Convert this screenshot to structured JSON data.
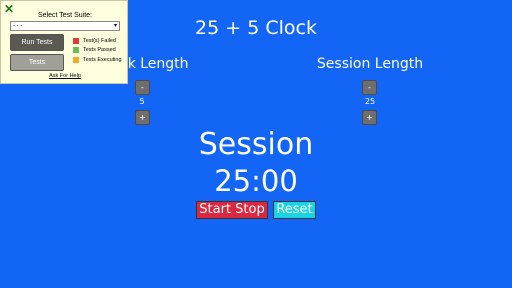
{
  "app": {
    "title": "25 + 5 Clock"
  },
  "break": {
    "label": "Break Length",
    "decrement": "-",
    "value": "5",
    "increment": "+"
  },
  "session": {
    "label": "Session Length",
    "decrement": "-",
    "value": "25",
    "increment": "+"
  },
  "timer": {
    "label": "Session",
    "time_left": "25:00"
  },
  "controls": {
    "start_stop": "Start Stop",
    "reset": "Reset"
  },
  "test_panel": {
    "close": "✕",
    "title": "Select Test Suite:",
    "select_value": "- - -",
    "run_tests": "Run Tests",
    "tests": "Tests",
    "legend": [
      {
        "label": "Test(s) Failed",
        "color": "#e53935"
      },
      {
        "label": "Tests Passed",
        "color": "#66c24a"
      },
      {
        "label": "Tests Executing",
        "color": "#f5a623"
      }
    ],
    "help": "Ask For Help"
  },
  "colors": {
    "background": "#1366f5",
    "start_stop": "#d9283f",
    "reset": "#1ad3e3"
  }
}
